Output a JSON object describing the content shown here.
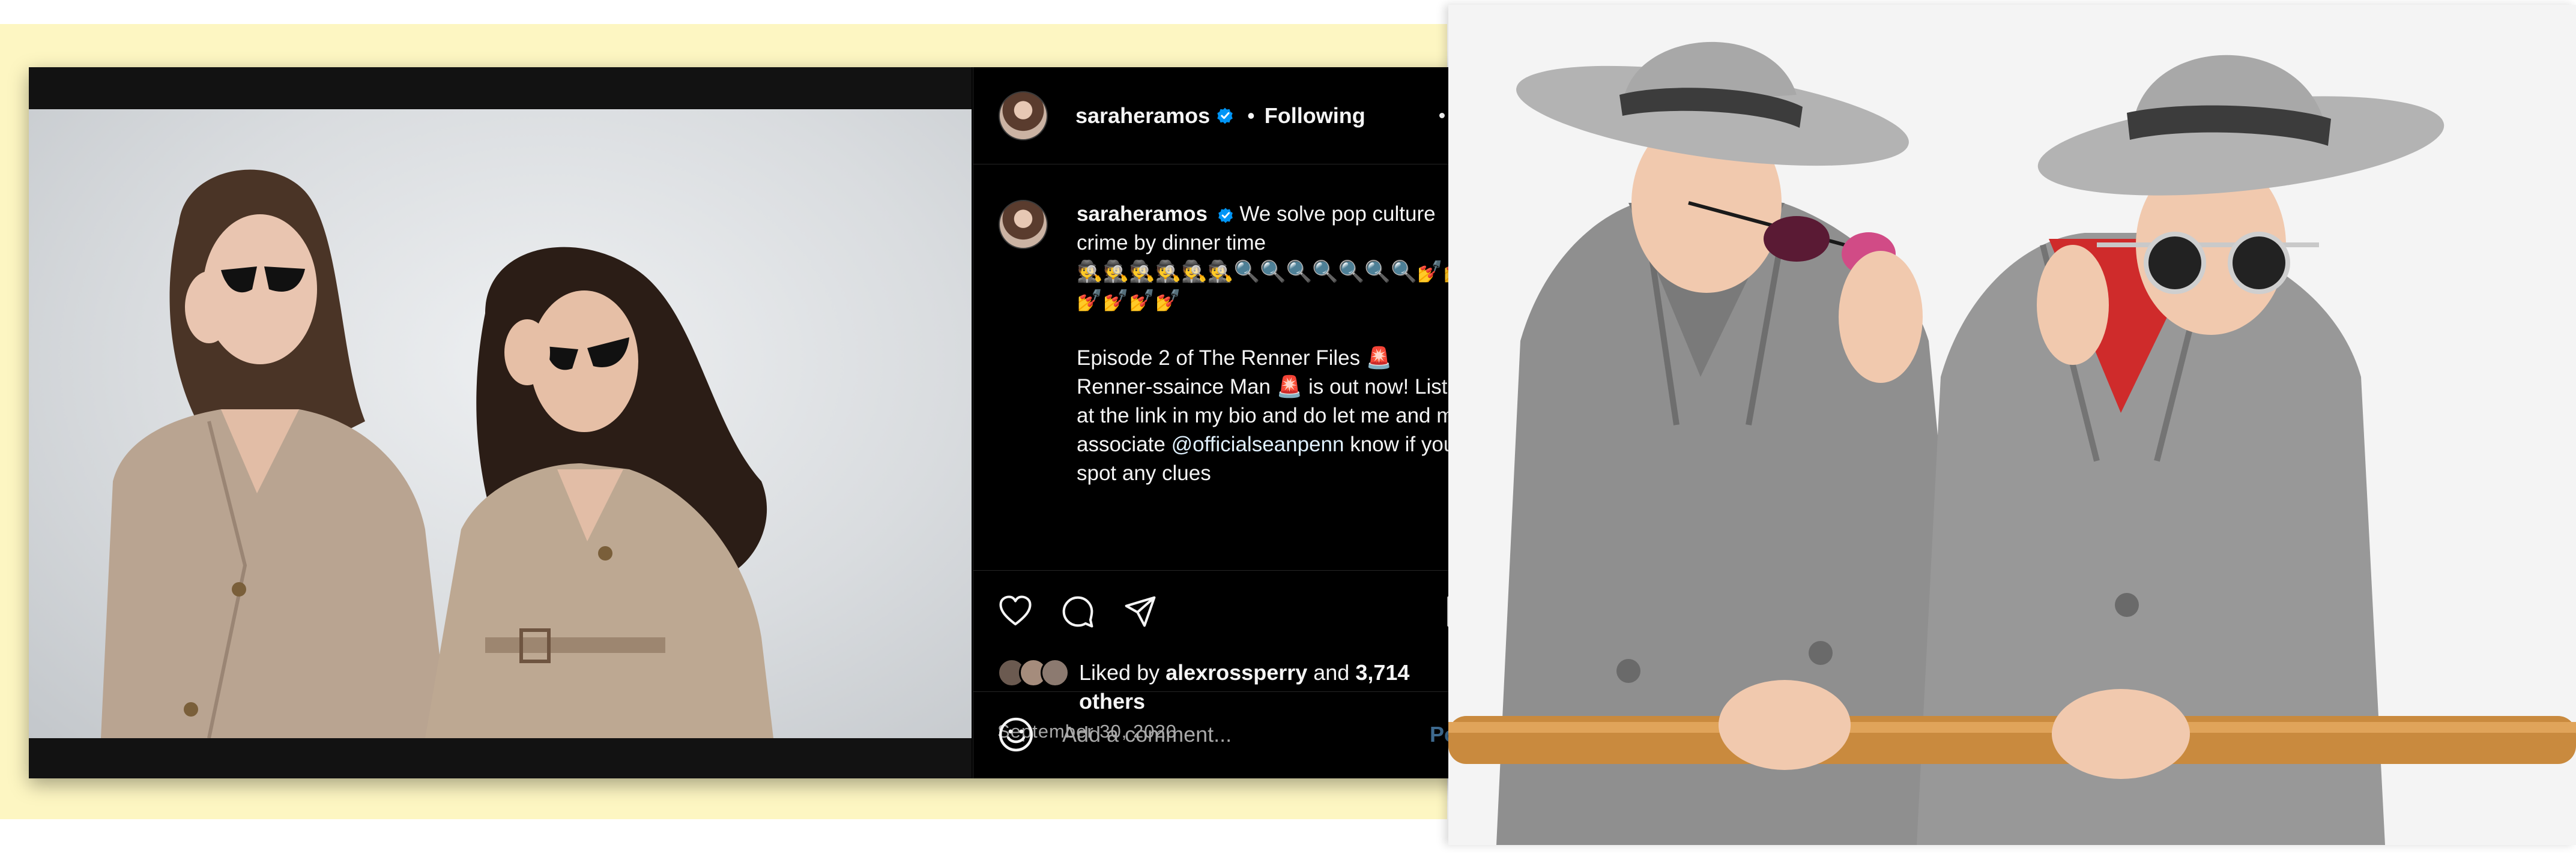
{
  "post": {
    "username": "saraheramos",
    "separator": "•",
    "follow_status": "Following",
    "caption": {
      "username": "saraheramos",
      "line1": "We solve pop culture crime by dinner time",
      "emoji_line": "🕵️🕵️🕵️🕵️🕵️🕵️🔍🔍🔍🔍🔍🔍🔍💅💅💅💅💅💅",
      "paragraph_prefix": "Episode 2 of The Renner Files 🚨 Renner-ssaince Man 🚨 is out now! Listen at the link in my bio and do let me and my associate ",
      "mention": "@officialseanpenn",
      "paragraph_suffix": " know if you spot any clues"
    },
    "likes": {
      "prefix": "Liked by ",
      "liked_by": "alexrossperry",
      "middle": " and ",
      "count": "3,714 others"
    },
    "date": "September 30, 2020",
    "comment_placeholder": "Add a comment...",
    "post_button": "Post",
    "carousel": {
      "total": 2,
      "active": 1
    }
  },
  "icons": [
    "verified-badge-icon",
    "more-options-icon",
    "heart-icon",
    "comment-icon",
    "share-icon",
    "bookmark-icon",
    "emoji-icon"
  ],
  "colors": {
    "backdrop_yellow": "#fdf6c2",
    "ig_background": "#000000",
    "verified_blue": "#0095f6",
    "post_button": "#3e6a8f"
  }
}
